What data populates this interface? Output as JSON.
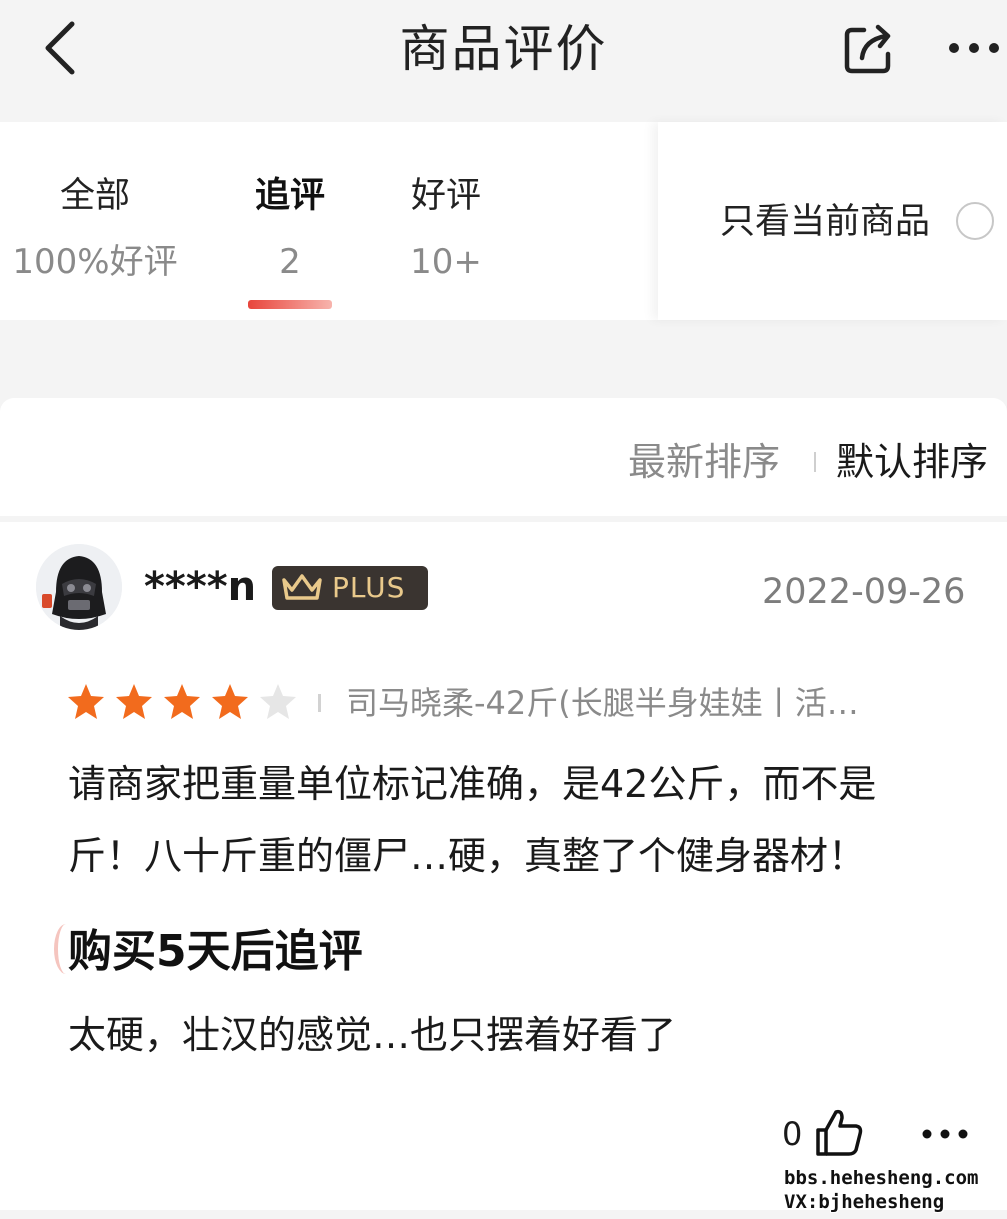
{
  "header": {
    "title": "商品评价",
    "back_icon": "chevron-left-icon",
    "share_icon": "share-icon",
    "more_icon": "more-horizontal-icon"
  },
  "tabs": [
    {
      "label": "全部",
      "count": "100%好评",
      "active": false
    },
    {
      "label": "追评",
      "count": "2",
      "active": true
    },
    {
      "label": "好评",
      "count": "10+",
      "active": false
    }
  ],
  "filter": {
    "label": "只看当前商品",
    "checked": false
  },
  "sort": {
    "latest": "最新排序",
    "default": "默认排序",
    "selected": "default"
  },
  "review": {
    "username": "****n",
    "badge": "PLUS",
    "date": "2022-09-26",
    "rating": 4,
    "rating_max": 5,
    "variant": "司马晓柔-42斤(长腿半身娃娃丨活…",
    "content_line1": "请商家把重量单位标记准确，是42公斤，而不是",
    "content_line2": "斤！八十斤重的僵尸…硬，真整了个健身器材！",
    "followup_title": "购买5天后追评",
    "followup_text": "太硬，壮汉的感觉…也只摆着好看了",
    "likes": "0"
  },
  "colors": {
    "accent": "#e8453c",
    "star": "#f26b1d",
    "star_empty": "#e6e6e6",
    "badge_bg": "#3a3430",
    "badge_text": "#e9c98b"
  },
  "watermark": {
    "line1": "bbs.hehesheng.com",
    "line2": "VX:bjhehesheng"
  }
}
